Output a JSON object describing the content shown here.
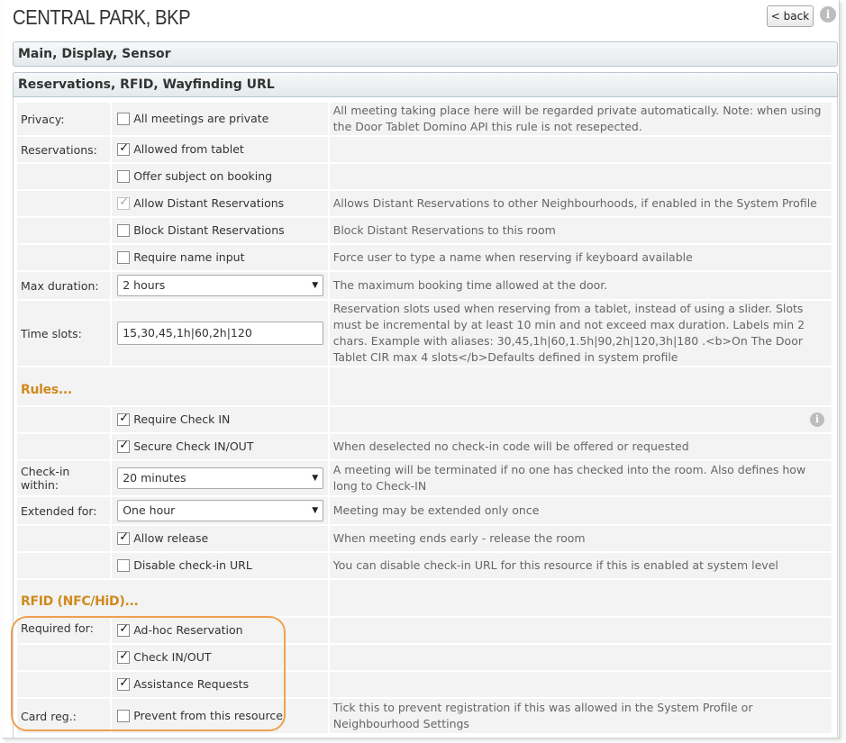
{
  "header": {
    "title": "CENTRAL PARK, BKP",
    "back_label": "< back",
    "info_glyph": "i"
  },
  "sections": {
    "main": "Main, Display, Sensor",
    "reservations": "Reservations, RFID, Wayfinding URL"
  },
  "rows": {
    "privacy": {
      "label": "Privacy:",
      "option": "All meetings are private",
      "checked": false,
      "desc": "All meeting taking place here will be regarded private automatically.  Note: when using the Door Tablet Domino API this rule is not resepected."
    },
    "reservations": {
      "label": "Reservations:",
      "option": "Allowed from tablet",
      "checked": true
    },
    "offer_subject": {
      "option": "Offer subject on booking",
      "checked": false
    },
    "allow_distant": {
      "option": "Allow Distant Reservations",
      "checked": true,
      "disabled": true,
      "desc": "Allows Distant Reservations to other Neighbourhoods, if enabled in the System Profile"
    },
    "block_distant": {
      "option": "Block Distant Reservations",
      "checked": false,
      "desc": "Block Distant Reservations to this room"
    },
    "require_name": {
      "option": "Require name input",
      "checked": false,
      "desc": "Force user to type a name when reserving if keyboard available"
    },
    "max_duration": {
      "label": "Max duration:",
      "value": "2 hours",
      "desc": "The maximum booking time allowed at the door."
    },
    "time_slots": {
      "label": "Time slots:",
      "value": "15,30,45,1h|60,2h|120",
      "desc": "Reservation slots used when reserving from a tablet, instead of using a slider. Slots must be incremental by at least 10 min and not exceed max duration. Labels min 2 chars. Example with aliases: 30,45,1h|60,1.5h|90,2h|120,3h|180 .<b>On The Door Tablet CIR max 4 slots</b>Defaults defined in system profile"
    },
    "rules_title": "Rules...",
    "require_checkin": {
      "option": "Require Check IN",
      "checked": true
    },
    "secure_checkin": {
      "option": "Secure Check IN/OUT",
      "checked": true,
      "desc": "When deselected no check-in code will be offered or requested"
    },
    "checkin_within": {
      "label": "Check-in within:",
      "value": "20 minutes",
      "desc": "A meeting will be terminated if no one has checked into the room. Also defines how long to Check-IN"
    },
    "extended_for": {
      "label": "Extended for:",
      "value": "One hour",
      "desc": "Meeting may be extended only once"
    },
    "allow_release": {
      "option": "Allow release",
      "checked": true,
      "desc": "When meeting ends early - release the room"
    },
    "disable_checkin_url": {
      "option": "Disable check-in URL",
      "checked": false,
      "desc": "You can disable check-in URL for this resource if this is enabled at system level"
    },
    "rfid_title": "RFID (NFC/HiD)...",
    "adhoc": {
      "label": "Required for:",
      "option": "Ad-hoc Reservation",
      "checked": true
    },
    "checkinout": {
      "option": "Check IN/OUT",
      "checked": true
    },
    "assistance": {
      "option": "Assistance Requests",
      "checked": true
    },
    "card_reg": {
      "label": "Card reg.:",
      "option": "Prevent from this resource",
      "checked": false,
      "desc": "Tick this to prevent registration if this was allowed in the System Profile or Neighbourhood Settings"
    }
  },
  "colors": {
    "section_title": "#d08a1f",
    "highlight": "#f0a050",
    "cell_bg": "#f3f3f3"
  },
  "icons": {
    "dropdown_arrow": "▼",
    "checkmark": "✓"
  }
}
